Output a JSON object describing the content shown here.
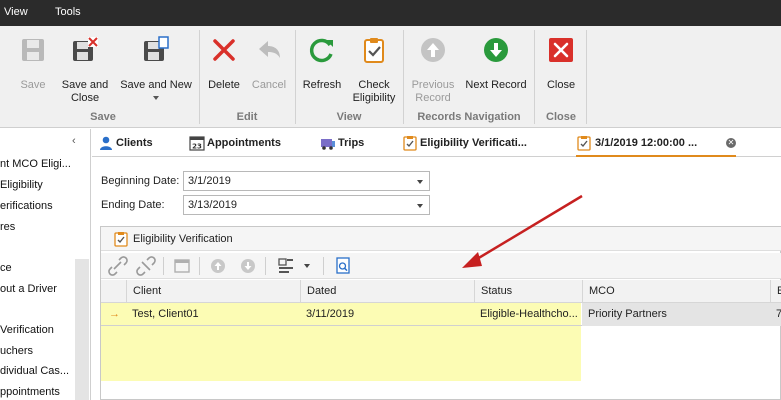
{
  "menu": {
    "items": [
      "View",
      "Tools"
    ]
  },
  "ribbon": {
    "buttons": {
      "save": "Save",
      "save_and_close_1": "Save and",
      "save_and_close_2": "Close",
      "save_and_new": "Save and New",
      "delete": "Delete",
      "cancel": "Cancel",
      "refresh": "Refresh",
      "check_eligibility_1": "Check",
      "check_eligibility_2": "Eligibility",
      "previous_record_1": "Previous",
      "previous_record_2": "Record",
      "next_record": "Next Record",
      "close": "Close"
    },
    "groups": {
      "save": "Save",
      "edit": "Edit",
      "view": "View",
      "records_navigation": "Records Navigation",
      "close": "Close"
    }
  },
  "leftnav": {
    "collapse": "‹",
    "items": [
      "nt MCO Eligi...",
      "Eligibility",
      "erifications",
      "res",
      "ce",
      "out a Driver",
      "Verification",
      "uchers",
      "dividual Cas...",
      "ppointments"
    ]
  },
  "tabs": [
    {
      "label": "Clients"
    },
    {
      "label": "Appointments"
    },
    {
      "label": "Trips"
    },
    {
      "label": "Eligibility Verificati..."
    },
    {
      "label": "3/1/2019 12:00:00 ..."
    }
  ],
  "form": {
    "beginning_label": "Beginning Date:",
    "beginning_value": "3/1/2019",
    "ending_label": "Ending Date:",
    "ending_value": "3/13/2019"
  },
  "panel": {
    "title": "Eligibility Verification",
    "columns": [
      "Client",
      "Dated",
      "Status",
      "MCO",
      "E"
    ],
    "rows": [
      {
        "indicator": "→",
        "client": "Test, Client01",
        "dated": "3/11/2019",
        "status": "Eligible-Healthcho...",
        "mco": "Priority Partners",
        "extra": "7"
      }
    ]
  },
  "colors": {
    "menubar": "#2b2b2b",
    "ribbon_bg": "#f0f0f0",
    "accent_green": "#2a9a3c",
    "delete_red": "#d9302a",
    "highlight_yellow": "#fcfcb0",
    "active_tab_underline": "#e08a1c",
    "arrow_red": "#c62020"
  }
}
